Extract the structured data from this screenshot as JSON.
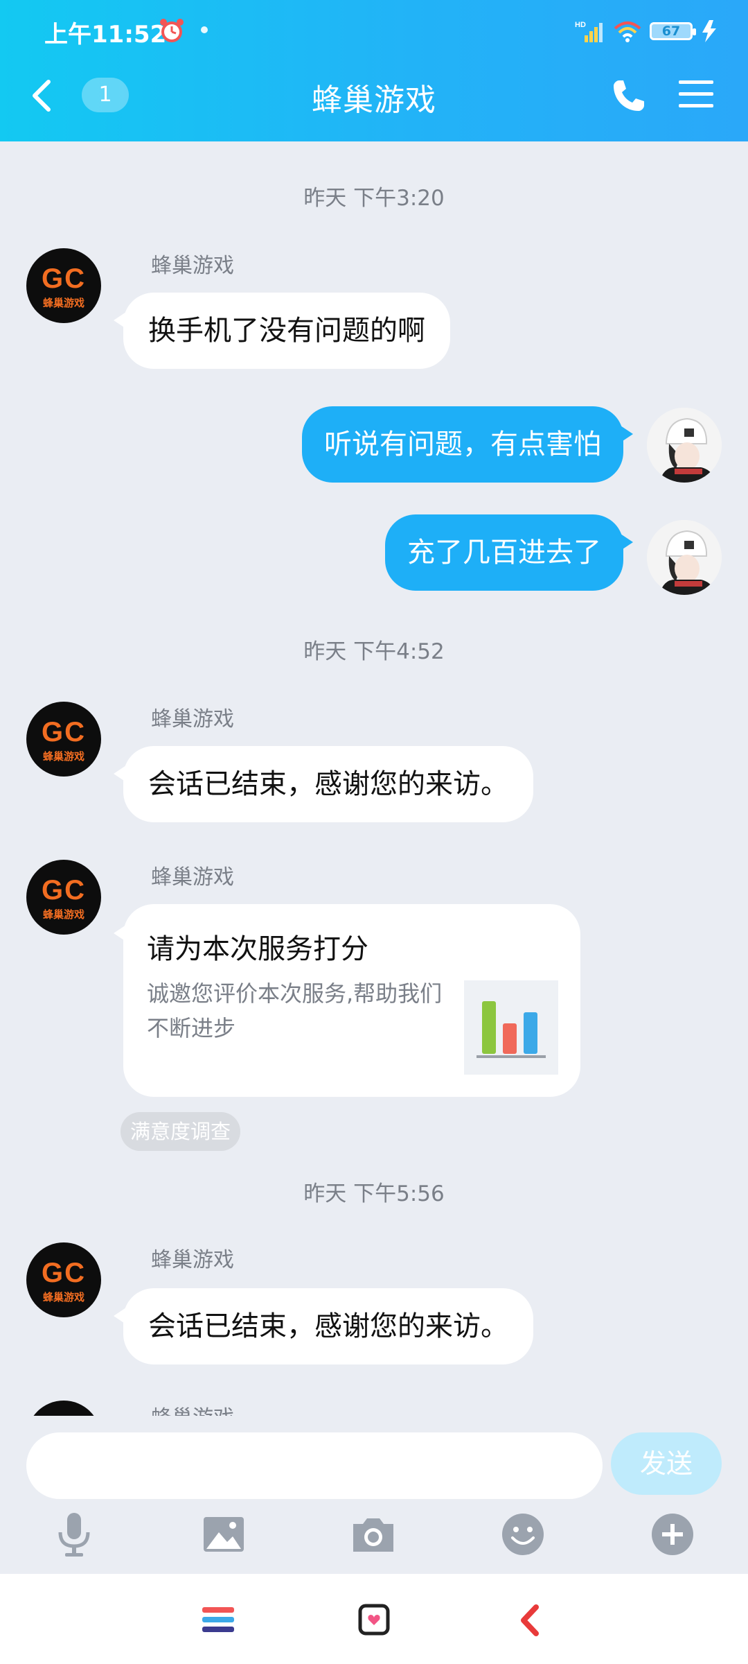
{
  "status_bar": {
    "time": "上午11:52",
    "battery": "67",
    "network": "HD"
  },
  "header": {
    "unread_count": "1",
    "title": "蜂巢游戏"
  },
  "messages": [
    {
      "type": "time",
      "text": "昨天 下午3:20"
    },
    {
      "type": "in",
      "sender": "蜂巢游戏",
      "text": "换手机了没有问题的啊"
    },
    {
      "type": "out",
      "text": "听说有问题，有点害怕"
    },
    {
      "type": "out",
      "text": "充了几百进去了"
    },
    {
      "type": "time",
      "text": "昨天 下午4:52"
    },
    {
      "type": "in",
      "sender": "蜂巢游戏",
      "text": "会话已结束，感谢您的来访。"
    },
    {
      "type": "card",
      "sender": "蜂巢游戏",
      "title": "请为本次服务打分",
      "desc": "诚邀您评价本次服务,帮助我们不断进步",
      "tag": "满意度调查"
    },
    {
      "type": "time",
      "text": "昨天 下午5:56"
    },
    {
      "type": "in",
      "sender": "蜂巢游戏",
      "text": "会话已结束，感谢您的来访。"
    },
    {
      "type": "in_partial",
      "sender": "蜂巢游戏"
    }
  ],
  "avatar_logo": {
    "main": "GC",
    "sub": "蜂巢游戏"
  },
  "composer": {
    "input_value": "",
    "send_label": "发送"
  },
  "toolbar_icons": [
    "mic-icon",
    "image-icon",
    "camera-icon",
    "emoji-icon",
    "plus-icon"
  ],
  "colors": {
    "header_start": "#13C9F2",
    "header_end": "#2AA8F9",
    "bubble_out": "#1EAFF7",
    "send_disabled": "#BFEBFC",
    "logo_orange": "#F26D21"
  }
}
